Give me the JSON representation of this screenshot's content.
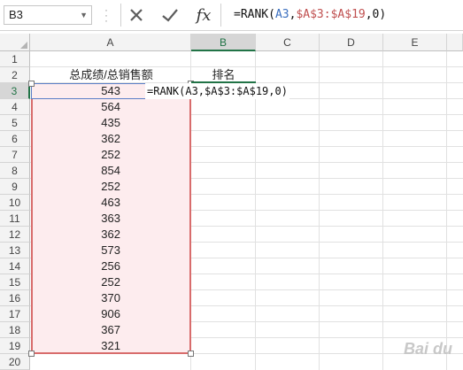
{
  "formula_bar": {
    "name_box": "B3",
    "cancel_icon": "x-icon",
    "enter_icon": "check-icon",
    "fx_label": "fx",
    "formula_prefix": "=RANK(",
    "formula_ref1": "A3",
    "formula_sep1": ",",
    "formula_ref2": "$A$3:$A$19",
    "formula_suffix": ",0)"
  },
  "columns": [
    "A",
    "B",
    "C",
    "D",
    "E"
  ],
  "rows": [
    "1",
    "2",
    "3",
    "4",
    "5",
    "6",
    "7",
    "8",
    "9",
    "10",
    "11",
    "12",
    "13",
    "14",
    "15",
    "16",
    "17",
    "18",
    "19",
    "20"
  ],
  "headers": {
    "col_a": "总成绩/总销售额",
    "col_b": "排名"
  },
  "values": [
    "543",
    "564",
    "435",
    "362",
    "252",
    "854",
    "252",
    "463",
    "363",
    "362",
    "573",
    "256",
    "252",
    "370",
    "906",
    "367",
    "321"
  ],
  "editing_text": "=RANK(A3,$A$3:$A$19,0)",
  "watermark": "Bai du"
}
